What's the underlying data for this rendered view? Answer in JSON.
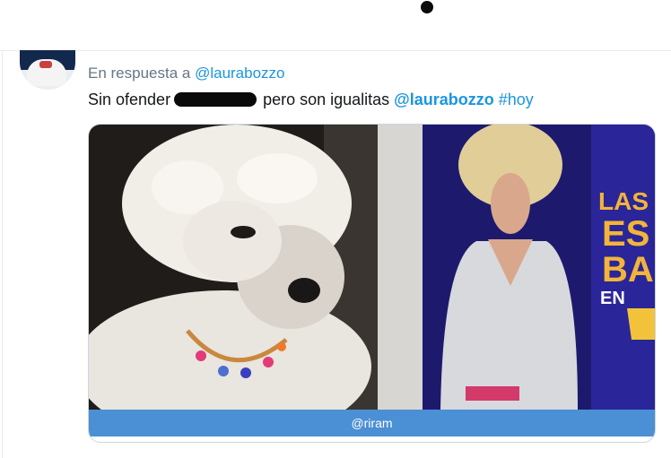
{
  "reply_prefix": "En respuesta a ",
  "reply_handle": "@laurabozzo",
  "tweet": {
    "text_before": "Sin ofender",
    "text_after": " pero son igualitas ",
    "mention": "@laurabozzo",
    "hashtag": "#hoy"
  },
  "media": {
    "credit": "@riram",
    "sign_text": [
      "LAS",
      "ES",
      "BA",
      "EN"
    ]
  },
  "colors": {
    "link": "#1b95e0",
    "muted": "#657786",
    "credit_bar": "#4b8fd4"
  }
}
